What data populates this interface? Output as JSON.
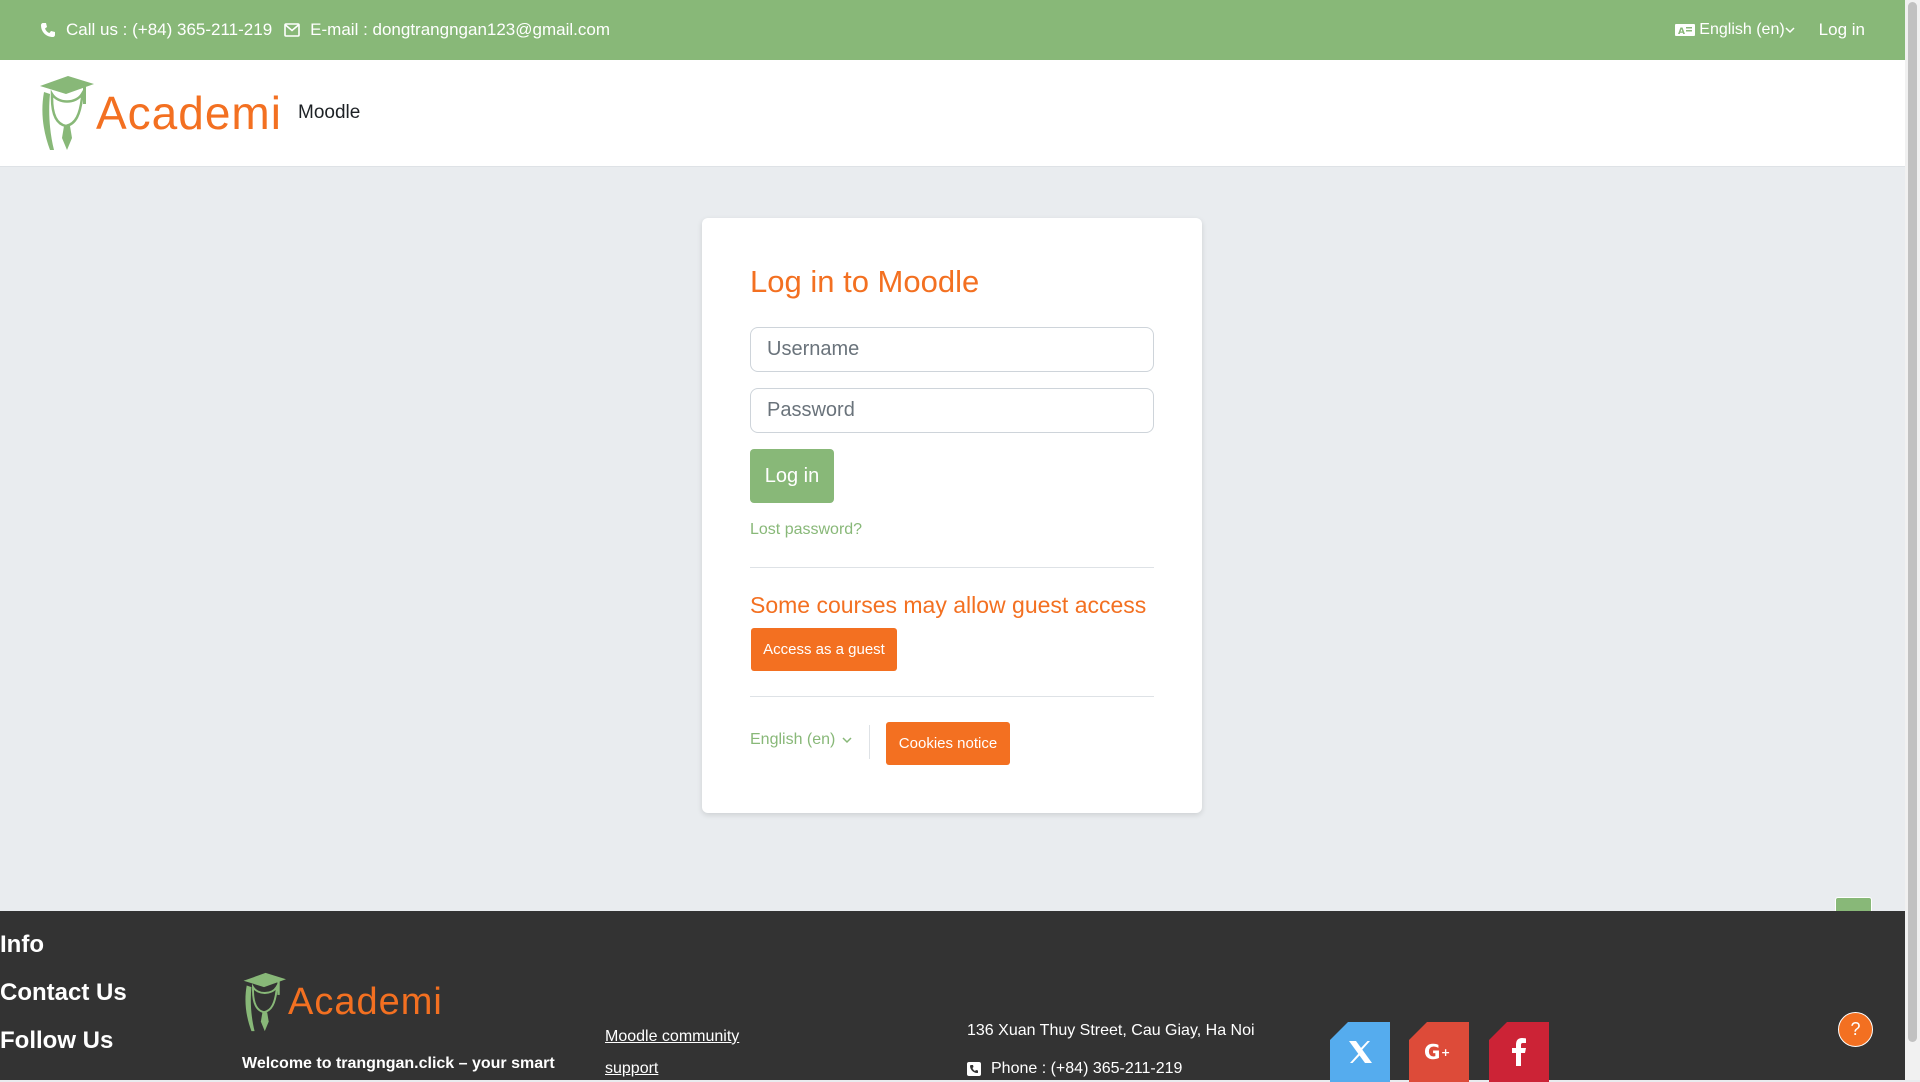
{
  "topbar": {
    "phone": "Call us : (+84) 365-211-219",
    "email": "E-mail : dongtrangngan123@gmail.com",
    "language": "English (en)",
    "login": "Log in"
  },
  "header": {
    "logo_text": "Academi",
    "site_name": "Moodle"
  },
  "login": {
    "title": "Log in to Moodle",
    "username_placeholder": "Username",
    "password_placeholder": "Password",
    "login_button": "Log in",
    "lost_password": "Lost password?",
    "guest_title": "Some courses may allow guest access",
    "guest_button": "Access as a guest",
    "language": "English (en)",
    "cookies_button": "Cookies notice"
  },
  "footer": {
    "logo_text": "Academi",
    "welcome": "Welcome to trangngan.click – your smart",
    "info_title": "Info",
    "info_link_1": "Moodle community",
    "info_link_2": "support",
    "contact_title": "Contact Us",
    "address": "136 Xuan Thuy Street, Cau Giay, Ha Noi",
    "phone": "Phone : (+84) 365-211-219",
    "follow_title": "Follow Us"
  },
  "help": {
    "label": "?"
  },
  "colors": {
    "accent_green": "#88b878",
    "accent_orange": "#f37021",
    "footer_bg": "#333333",
    "twitter": "#55acee",
    "google_plus": "#dd4b39",
    "facebook": "#cc2336"
  }
}
